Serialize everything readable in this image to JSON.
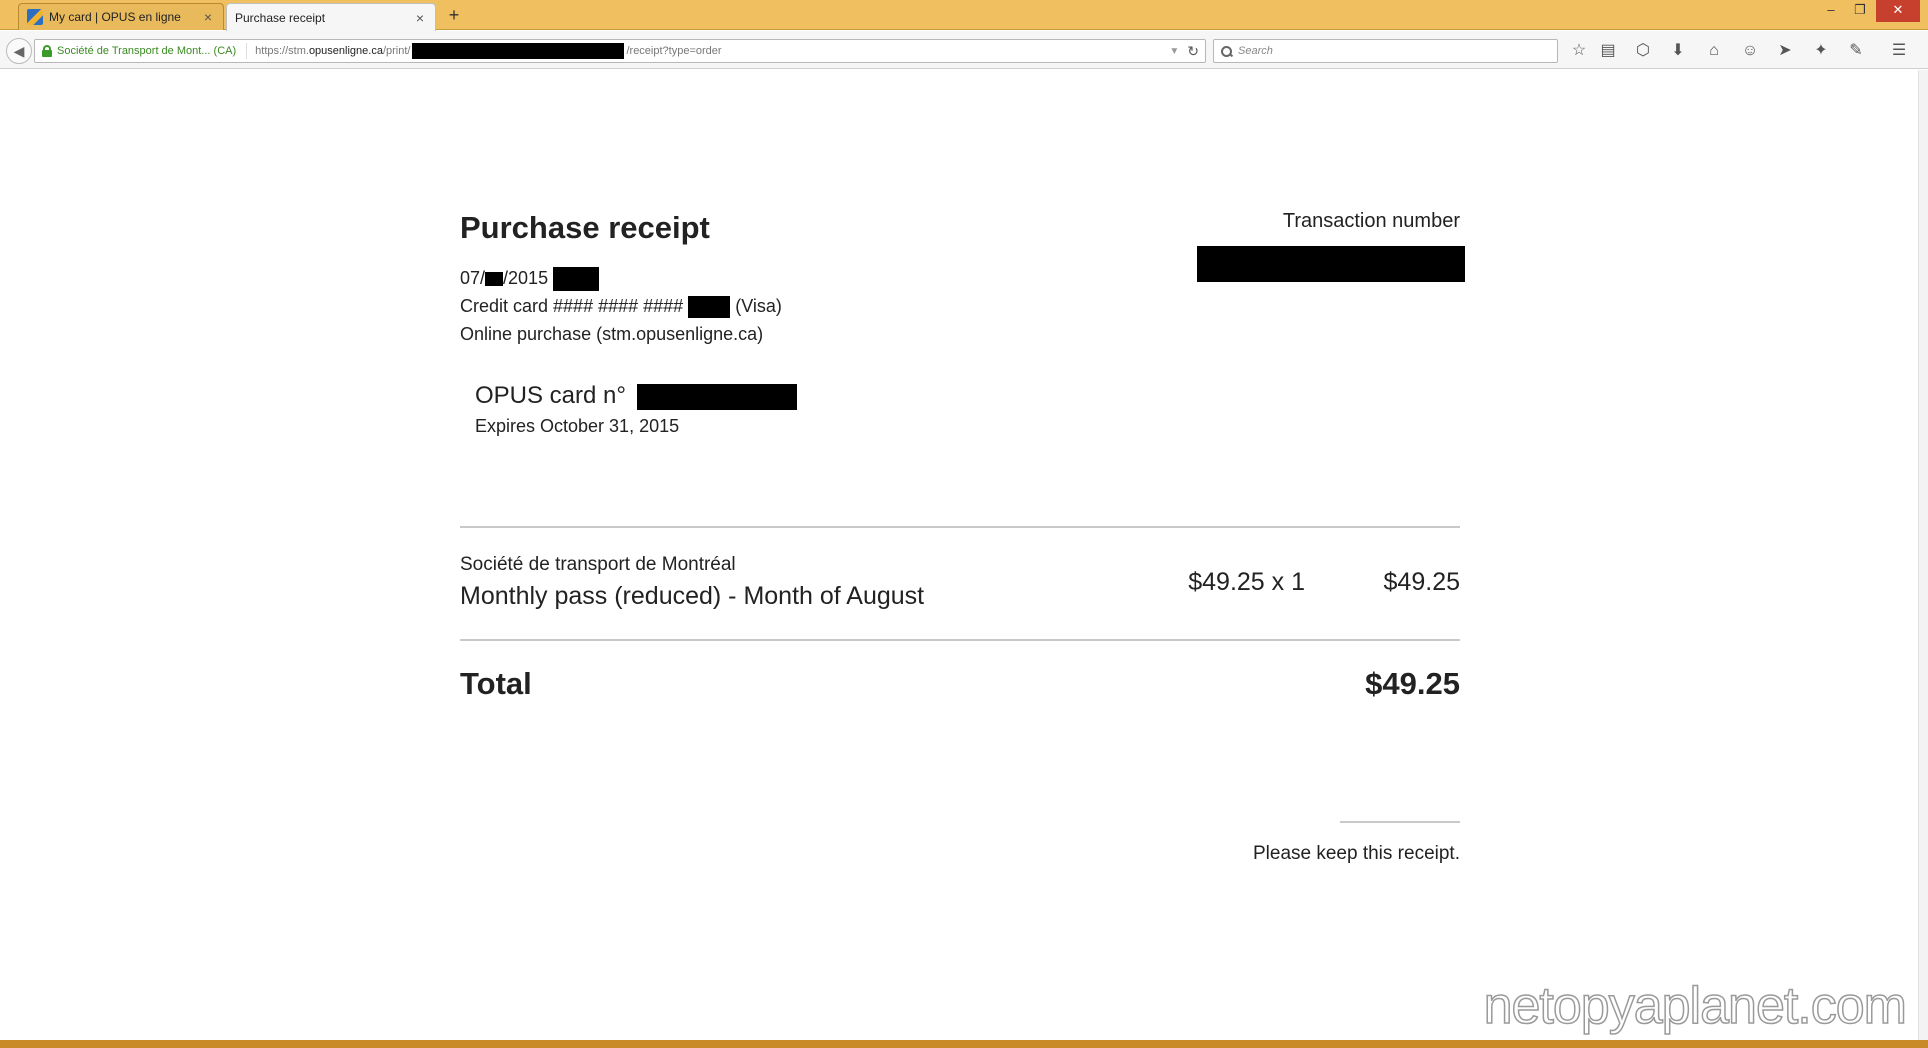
{
  "browser": {
    "tabs": [
      {
        "title": "My card | OPUS en ligne",
        "active": false
      },
      {
        "title": "Purchase receipt",
        "active": true
      }
    ],
    "new_tab_symbol": "+",
    "close_symbol": "×",
    "window_controls": {
      "minimize": "–",
      "restore": "❐",
      "close": "✕"
    },
    "identity_label": "Société de Transport de Mont...  (CA)",
    "url_prefix": "https://stm.",
    "url_host": "opusenligne.ca",
    "url_path_a": "/print/",
    "url_path_b": "/receipt?type=order",
    "search_placeholder": "Search",
    "toolbar_icons": [
      "bookmark-star-icon",
      "reading-list-icon",
      "pocket-icon",
      "download-icon",
      "home-icon",
      "chat-icon",
      "send-icon",
      "extension-icon",
      "sync-icon",
      "menu-icon"
    ]
  },
  "receipt": {
    "title": "Purchase receipt",
    "transaction_label": "Transaction number",
    "date_prefix": "07/",
    "date_suffix": "/2015",
    "card_prefix": "Credit card #### #### ####",
    "card_suffix": "(Visa)",
    "channel": "Online purchase (stm.opusenligne.ca)",
    "opus_label": "OPUS card n°",
    "expiry": "Expires October 31, 2015",
    "operator": "Société de transport de Montréal",
    "product": "Monthly pass (reduced) - Month of August",
    "unit_price": "$49.25 x 1",
    "line_total": "$49.25",
    "total_label": "Total",
    "total_value": "$49.25",
    "keep_note": "Please keep this receipt."
  },
  "watermark": "netopyaplanet.com"
}
